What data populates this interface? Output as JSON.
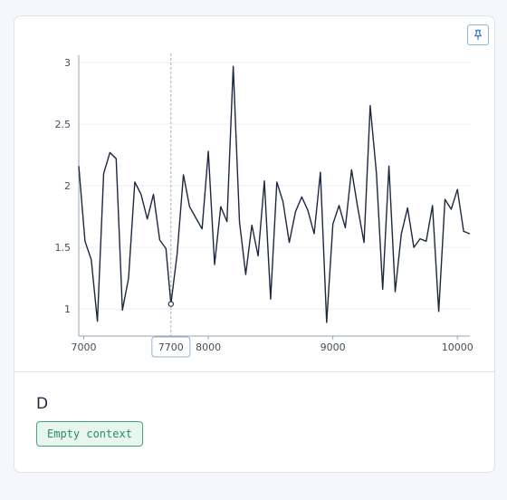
{
  "pin_icon": "pin-icon",
  "series_title": "D",
  "context_badge": "Empty context",
  "colors": {
    "line": "#1c2740",
    "grid": "#e8ecf2",
    "axis": "#9aa3b2",
    "cursor": "#a7aebb",
    "cursor_label_border": "#8fb0d8",
    "badge_border": "#3ea878",
    "badge_bg": "#e7f6ee",
    "badge_text": "#2e8b5f"
  },
  "chart_data": {
    "type": "line",
    "xlim": [
      6960,
      10100
    ],
    "ylim": [
      0.78,
      3.06
    ],
    "x_ticks": [
      7000,
      8000,
      9000,
      10000
    ],
    "x_tick_labels": [
      "7000",
      "8000",
      "9000",
      "10000"
    ],
    "y_ticks": [
      1,
      1.5,
      2,
      2.5,
      3
    ],
    "y_tick_labels": [
      "1",
      "1.5",
      "2",
      "2.5",
      "3"
    ],
    "grid": "horizontal",
    "cursor": {
      "x": 7700,
      "y": 1.04,
      "label": "7700"
    },
    "x": [
      6960,
      7010,
      7060,
      7110,
      7160,
      7210,
      7260,
      7310,
      7360,
      7410,
      7460,
      7510,
      7560,
      7610,
      7660,
      7700,
      7750,
      7800,
      7850,
      7900,
      7950,
      8000,
      8050,
      8100,
      8150,
      8200,
      8250,
      8300,
      8350,
      8400,
      8450,
      8500,
      8550,
      8600,
      8650,
      8700,
      8750,
      8800,
      8850,
      8900,
      8950,
      9000,
      9050,
      9100,
      9150,
      9200,
      9250,
      9300,
      9350,
      9400,
      9450,
      9500,
      9550,
      9600,
      9650,
      9700,
      9750,
      9800,
      9850,
      9900,
      9950,
      10000,
      10050,
      10100
    ],
    "y": [
      2.16,
      1.55,
      1.4,
      0.9,
      2.1,
      2.27,
      2.22,
      0.99,
      1.25,
      2.03,
      1.93,
      1.73,
      1.93,
      1.56,
      1.49,
      1.04,
      1.45,
      2.09,
      1.83,
      1.74,
      1.65,
      2.28,
      1.36,
      1.83,
      1.71,
      2.97,
      1.71,
      1.28,
      1.68,
      1.43,
      2.04,
      1.08,
      2.03,
      1.87,
      1.54,
      1.79,
      1.91,
      1.8,
      1.61,
      2.11,
      0.89,
      1.69,
      1.84,
      1.66,
      2.13,
      1.82,
      1.54,
      2.65,
      2.1,
      1.16,
      2.16,
      1.14,
      1.61,
      1.82,
      1.5,
      1.57,
      1.55,
      1.84,
      0.98,
      1.89,
      1.81,
      1.97,
      1.63,
      1.61
    ]
  }
}
